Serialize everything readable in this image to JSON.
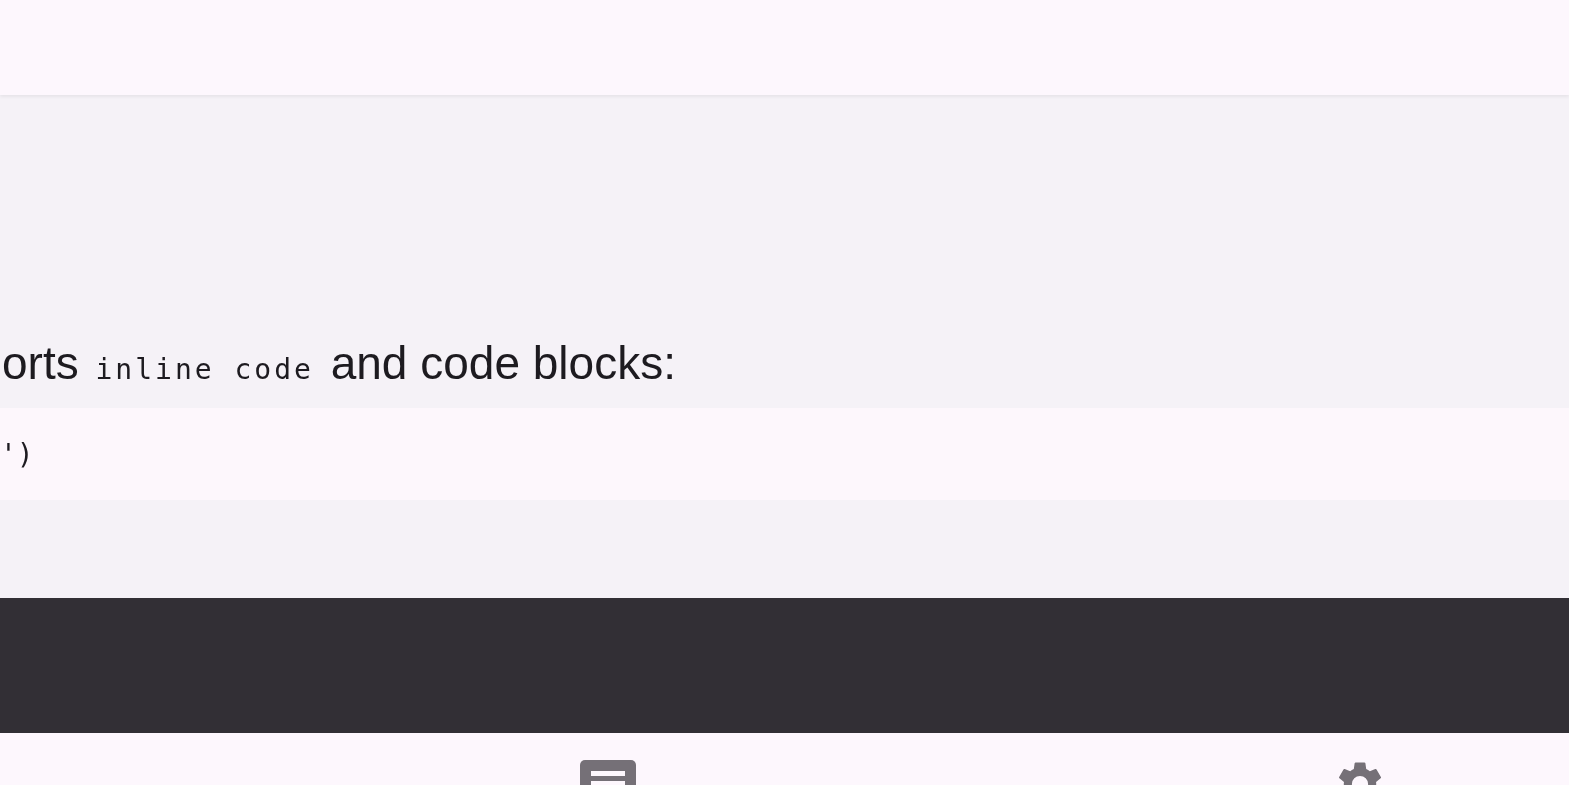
{
  "message": {
    "text_before": "orts",
    "inline_code": "inline code",
    "text_after": "and code blocks:"
  },
  "code_block": {
    "lines": [
      "')"
    ]
  },
  "bottom_nav": [
    {
      "kind": "article"
    },
    {
      "kind": "settings"
    }
  ]
}
